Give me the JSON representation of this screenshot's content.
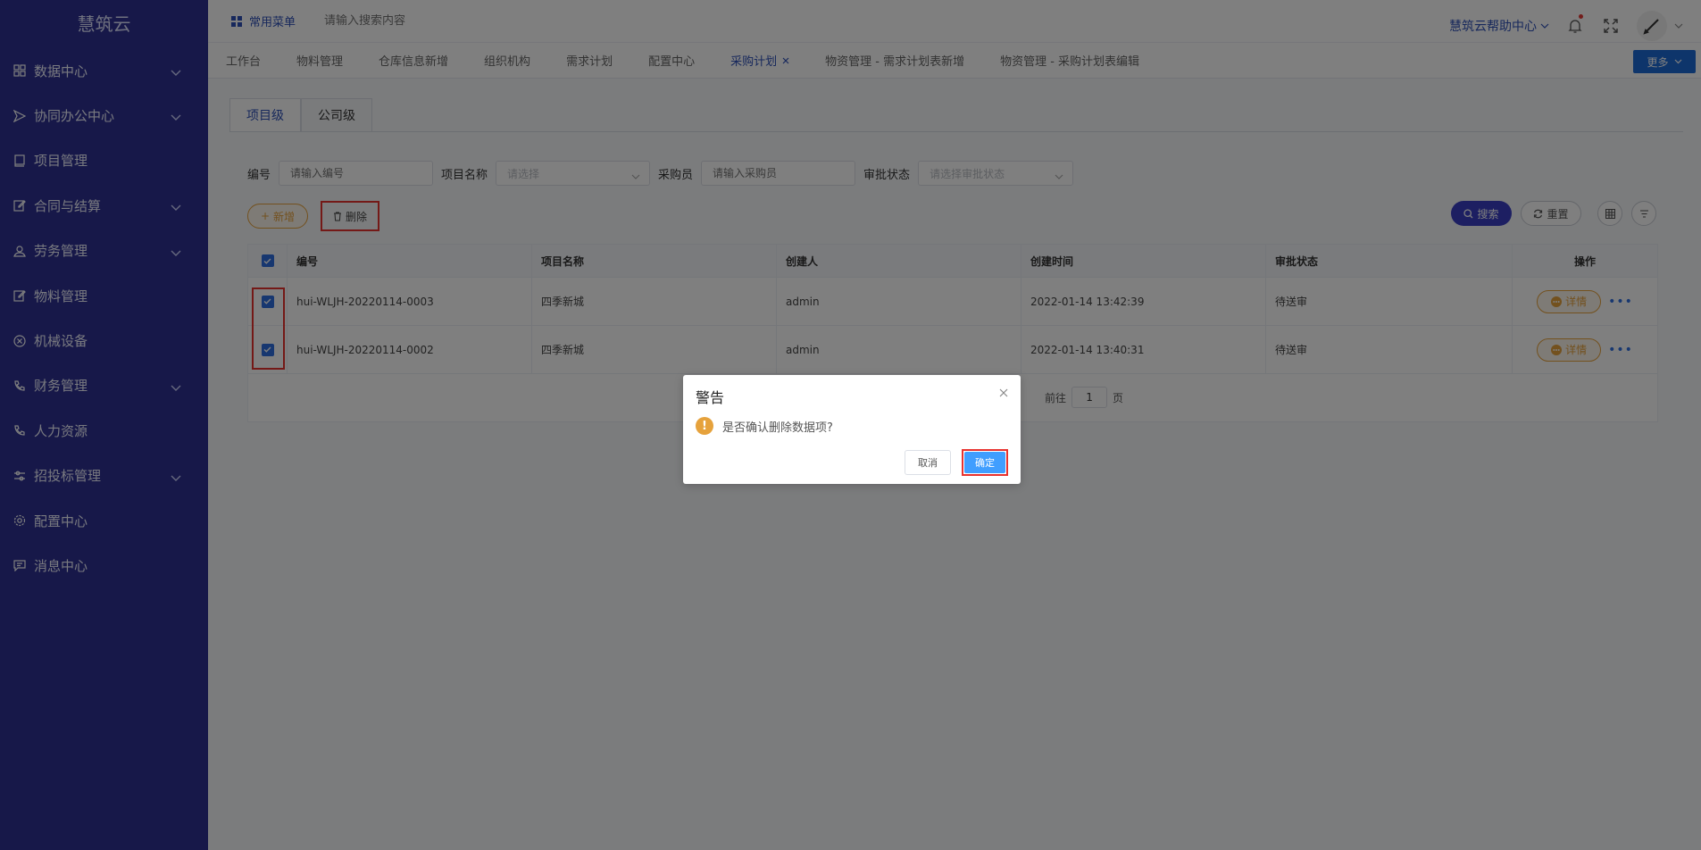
{
  "app": {
    "title": "慧筑云"
  },
  "sidebar": {
    "items": [
      {
        "label": "数据中心",
        "has_children": true
      },
      {
        "label": "协同办公中心",
        "has_children": true
      },
      {
        "label": "项目管理",
        "has_children": false
      },
      {
        "label": "合同与结算",
        "has_children": true
      },
      {
        "label": "劳务管理",
        "has_children": true
      },
      {
        "label": "物料管理",
        "has_children": false
      },
      {
        "label": "机械设备",
        "has_children": false
      },
      {
        "label": "财务管理",
        "has_children": true
      },
      {
        "label": "人力资源",
        "has_children": false
      },
      {
        "label": "招投标管理",
        "has_children": true
      },
      {
        "label": "配置中心",
        "has_children": false
      },
      {
        "label": "消息中心",
        "has_children": false
      }
    ]
  },
  "topbar": {
    "favorites_label": "常用菜单",
    "search_placeholder": "请输入搜索内容",
    "help_label": "慧筑云帮助中心"
  },
  "nav_tabs": {
    "items": [
      "工作台",
      "物料管理",
      "仓库信息新增",
      "组织机构",
      "需求计划",
      "配置中心",
      "采购计划",
      "物资管理 - 需求计划表新增",
      "物资管理 - 采购计划表编辑"
    ],
    "active_index": 6,
    "more_label": "更多"
  },
  "scope_tabs": {
    "project": "项目级",
    "company": "公司级"
  },
  "filters": {
    "code_label": "编号",
    "code_placeholder": "请输入编号",
    "project_label": "项目名称",
    "project_placeholder": "请选择",
    "buyer_label": "采购员",
    "buyer_placeholder": "请输入采购员",
    "status_label": "审批状态",
    "status_placeholder": "请选择审批状态"
  },
  "actions": {
    "add": "新增",
    "delete": "删除",
    "search": "搜索",
    "reset": "重置"
  },
  "table": {
    "headers": [
      "编号",
      "项目名称",
      "创建人",
      "创建时间",
      "审批状态",
      "操作"
    ],
    "rows": [
      {
        "code": "hui-WLJH-20220114-0003",
        "project": "四季新城",
        "creator": "admin",
        "created": "2022-01-14 13:42:39",
        "status": "待送审",
        "action": "详情"
      },
      {
        "code": "hui-WLJH-20220114-0002",
        "project": "四季新城",
        "creator": "admin",
        "created": "2022-01-14 13:40:31",
        "status": "待送审",
        "action": "详情"
      }
    ]
  },
  "pager": {
    "goto": "前往",
    "page": "1",
    "unit": "页"
  },
  "dialog": {
    "title": "警告",
    "message": "是否确认删除数据项?",
    "cancel": "取消",
    "confirm": "确定"
  },
  "colors": {
    "sidebar": "#2e3192",
    "accent": "#2e51b8",
    "warning": "#e6a23c",
    "primary": "#409eff",
    "highlight": "#e8322e"
  }
}
